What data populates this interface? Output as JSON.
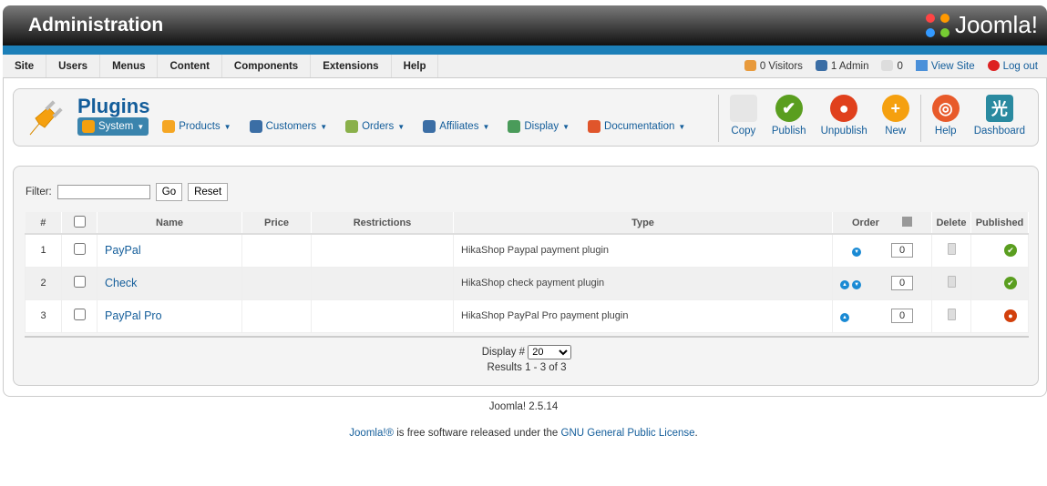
{
  "header": {
    "title": "Administration",
    "logo_text": "Joomla!"
  },
  "menu": [
    "Site",
    "Users",
    "Menus",
    "Content",
    "Components",
    "Extensions",
    "Help"
  ],
  "status": {
    "visitors": "0 Visitors",
    "admin": "1 Admin",
    "messages": "0",
    "view_site": "View Site",
    "logout": "Log out"
  },
  "toolbar": {
    "title": "Plugins",
    "submenu": [
      {
        "label": "System",
        "active": true,
        "color": "#3a84ad"
      },
      {
        "label": "Products",
        "color": "#f5a623"
      },
      {
        "label": "Customers",
        "color": "#3b6ea5"
      },
      {
        "label": "Orders",
        "color": "#8ab04a"
      },
      {
        "label": "Affiliates",
        "color": "#3b6ea5"
      },
      {
        "label": "Display",
        "color": "#4a9b5a"
      },
      {
        "label": "Documentation",
        "color": "#e0552b"
      }
    ],
    "buttons": [
      {
        "label": "Copy",
        "color": "#e6e6e6"
      },
      {
        "label": "Publish",
        "color": "#5a9e1f"
      },
      {
        "label": "Unpublish",
        "color": "#e0401c"
      },
      {
        "label": "New",
        "color": "#f5a00f"
      },
      {
        "label": "Help",
        "color": "#e85a2a"
      },
      {
        "label": "Dashboard",
        "color": "#2a8aa0"
      }
    ]
  },
  "filter": {
    "label": "Filter:",
    "value": "",
    "go": "Go",
    "reset": "Reset"
  },
  "table": {
    "headers": [
      "#",
      "",
      "Name",
      "Price",
      "Restrictions",
      "Type",
      "Order",
      "Delete",
      "Published"
    ],
    "rows": [
      {
        "num": "1",
        "name": "PayPal",
        "price": "",
        "restrictions": "",
        "type": "HikaShop Paypal payment plugin",
        "up": false,
        "down": true,
        "order": "0",
        "published": true
      },
      {
        "num": "2",
        "name": "Check",
        "price": "",
        "restrictions": "",
        "type": "HikaShop check payment plugin",
        "up": true,
        "down": true,
        "order": "0",
        "published": true
      },
      {
        "num": "3",
        "name": "PayPal Pro",
        "price": "",
        "restrictions": "",
        "type": "HikaShop PayPal Pro payment plugin",
        "up": true,
        "down": false,
        "order": "0",
        "published": false
      }
    ]
  },
  "pagination": {
    "display_label": "Display #",
    "display_value": "20",
    "results": "Results 1 - 3 of 3"
  },
  "footer": {
    "version": "Joomla! 2.5.14",
    "license_pre": "Joomla!®",
    "license_mid": " is free software released under the ",
    "license_link": "GNU General Public License",
    "license_post": "."
  }
}
